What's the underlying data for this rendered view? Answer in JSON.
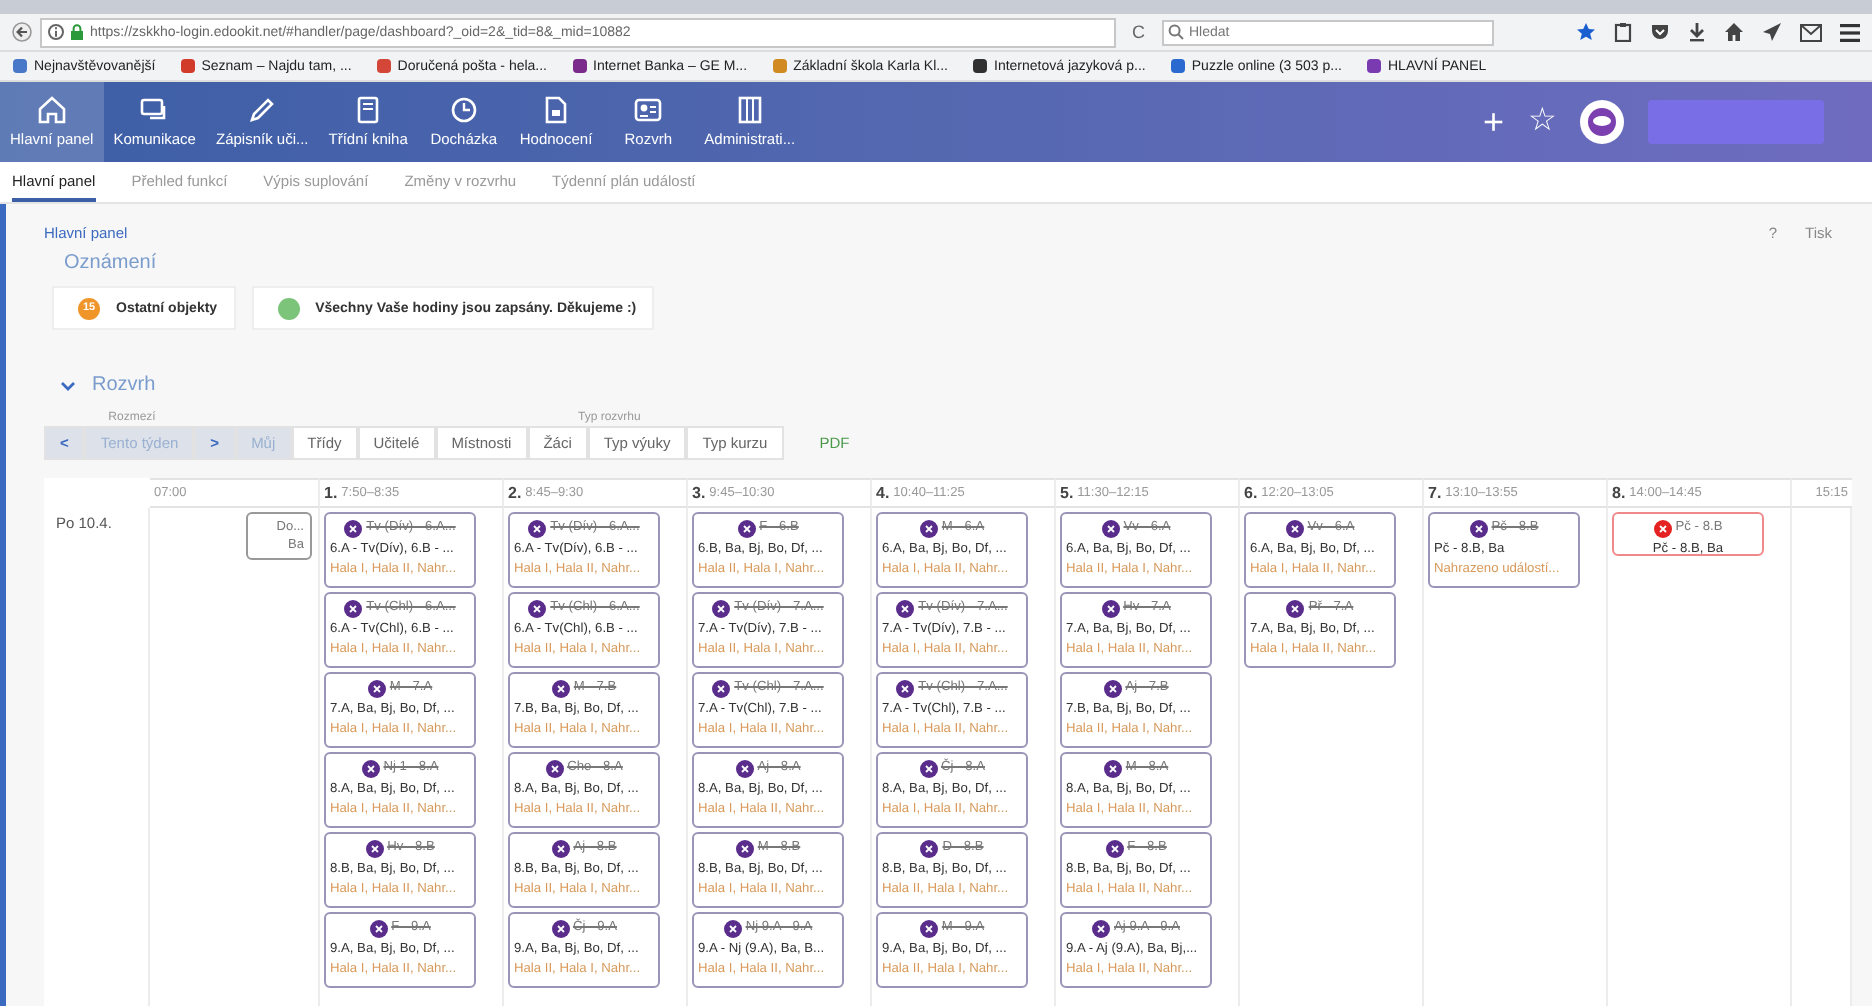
{
  "browser": {
    "url": "https://zskkho-login.edookit.net/#handler/page/dashboard?_oid=2&_tid=8&_mid=10882",
    "reload": "C",
    "search_placeholder": "Hledat",
    "bookmarks": [
      {
        "label": "Nejnavštěvovanější",
        "color": "#4a78c8"
      },
      {
        "label": "Seznam – Najdu tam, ...",
        "color": "#d23a2a"
      },
      {
        "label": "Doručená pošta - hela...",
        "color": "#d44638"
      },
      {
        "label": "Internet Banka – GE M...",
        "color": "#7a2a8a"
      },
      {
        "label": "Základní škola Karla Kl...",
        "color": "#d08a20"
      },
      {
        "label": "Internetová jazyková p...",
        "color": "#303030"
      },
      {
        "label": "Puzzle online (3 503 p...",
        "color": "#2a6ad0"
      },
      {
        "label": "HLAVNÍ PANEL",
        "color": "#7a3ab0"
      }
    ]
  },
  "app_nav": {
    "items": [
      {
        "label": "Hlavní panel",
        "selected": true
      },
      {
        "label": "Komunikace",
        "selected": false
      },
      {
        "label": "Zápisník uči...",
        "selected": false
      },
      {
        "label": "Třídní kniha",
        "selected": false
      },
      {
        "label": "Docházka",
        "selected": false
      },
      {
        "label": "Hodnocení",
        "selected": false
      },
      {
        "label": "Rozvrh",
        "selected": false
      },
      {
        "label": "Administrati...",
        "selected": false
      }
    ],
    "add": "+",
    "favorite": "☆"
  },
  "sub_tabs": [
    {
      "label": "Hlavní panel",
      "selected": true
    },
    {
      "label": "Přehled funkcí",
      "selected": false
    },
    {
      "label": "Výpis suplování",
      "selected": false
    },
    {
      "label": "Změny v rozvrhu",
      "selected": false
    },
    {
      "label": "Týdenní plán událostí",
      "selected": false
    }
  ],
  "breadcrumb": "Hlavní panel",
  "help": "?",
  "print": "Tisk",
  "announcements": {
    "title": "Oznámení",
    "items": [
      {
        "kind": "count",
        "badge": "15",
        "text": "Ostatní objekty"
      },
      {
        "kind": "ok",
        "text": "Všechny Vaše hodiny jsou zapsány. Děkujeme :)"
      }
    ]
  },
  "timetable": {
    "title": "Rozvrh",
    "expanded": true,
    "range_label": "Rozmezí",
    "prev": "<",
    "range": "Tento týden",
    "next": ">",
    "type_label": "Typ rozvrhu",
    "types": [
      {
        "label": "Můj",
        "selected": true
      },
      {
        "label": "Třídy",
        "selected": false
      },
      {
        "label": "Učitelé",
        "selected": false
      },
      {
        "label": "Místnosti",
        "selected": false
      },
      {
        "label": "Žáci",
        "selected": false
      },
      {
        "label": "Typ výuky",
        "selected": false
      },
      {
        "label": "Typ kurzu",
        "selected": false
      }
    ],
    "pdf": "PDF",
    "start_time": "07:00",
    "end_time": "15:15",
    "periods": [
      {
        "number": "1.",
        "time": "7:50–8:35"
      },
      {
        "number": "2.",
        "time": "8:45–9:30"
      },
      {
        "number": "3.",
        "time": "9:45–10:30"
      },
      {
        "number": "4.",
        "time": "10:40–11:25"
      },
      {
        "number": "5.",
        "time": "11:30–12:15"
      },
      {
        "number": "6.",
        "time": "12:20–13:05"
      },
      {
        "number": "7.",
        "time": "13:10–13:55"
      },
      {
        "number": "8.",
        "time": "14:00–14:45"
      }
    ],
    "day": {
      "label": "Po 10.4.",
      "early": {
        "title": "Do...",
        "line_2": "Ba"
      },
      "columns": [
        [
          {
            "title": "Tv (Dív) - 6.A...",
            "cancelled": true,
            "alert": false,
            "line_2": "6.A - Tv(Dív), 6.B - ...",
            "line_3": "Hala I, Hala II, Nahr..."
          },
          {
            "title": "Tv (Chl) - 6.A...",
            "cancelled": true,
            "alert": false,
            "line_2": "6.A - Tv(Chl), 6.B - ...",
            "line_3": "Hala I, Hala II, Nahr..."
          },
          {
            "title": "M - 7.A",
            "cancelled": true,
            "alert": false,
            "line_2": "7.A, Ba, Bj, Bo, Df, ...",
            "line_3": "Hala I, Hala II, Nahr..."
          },
          {
            "title": "Nj 1 - 8.A",
            "cancelled": true,
            "alert": false,
            "line_2": "8.A, Ba, Bj, Bo, Df, ...",
            "line_3": "Hala I, Hala II, Nahr..."
          },
          {
            "title": "Hv - 8.B",
            "cancelled": true,
            "alert": false,
            "line_2": "8.B, Ba, Bj, Bo, Df, ...",
            "line_3": "Hala I, Hala II, Nahr..."
          },
          {
            "title": "F - 9.A",
            "cancelled": true,
            "alert": false,
            "line_2": "9.A, Ba, Bj, Bo, Df, ...",
            "line_3": "Hala I, Hala II, Nahr..."
          }
        ],
        [
          {
            "title": "Tv (Dív) - 6.A...",
            "cancelled": true,
            "alert": false,
            "line_2": "6.A - Tv(Dív), 6.B - ...",
            "line_3": "Hala I, Hala II, Nahr..."
          },
          {
            "title": "Tv (Chl) - 6.A...",
            "cancelled": true,
            "alert": false,
            "line_2": "6.A - Tv(Chl), 6.B - ...",
            "line_3": "Hala II, Hala I, Nahr..."
          },
          {
            "title": "M - 7.B",
            "cancelled": true,
            "alert": false,
            "line_2": "7.B, Ba, Bj, Bo, Df, ...",
            "line_3": "Hala II, Hala I, Nahr..."
          },
          {
            "title": "Che - 8.A",
            "cancelled": true,
            "alert": false,
            "line_2": "8.A, Ba, Bj, Bo, Df, ...",
            "line_3": "Hala I, Hala II, Nahr..."
          },
          {
            "title": "Aj - 8.B",
            "cancelled": true,
            "alert": false,
            "line_2": "8.B, Ba, Bj, Bo, Df, ...",
            "line_3": "Hala II, Hala I, Nahr..."
          },
          {
            "title": "Čj - 9.A",
            "cancelled": true,
            "alert": false,
            "line_2": "9.A, Ba, Bj, Bo, Df, ...",
            "line_3": "Hala II, Hala I, Nahr..."
          }
        ],
        [
          {
            "title": "F - 6.B",
            "cancelled": true,
            "alert": false,
            "line_2": "6.B, Ba, Bj, Bo, Df, ...",
            "line_3": "Hala II, Hala I, Nahr..."
          },
          {
            "title": "Tv (Dív) - 7.A...",
            "cancelled": true,
            "alert": false,
            "line_2": "7.A - Tv(Dív), 7.B - ...",
            "line_3": "Hala II, Hala I, Nahr..."
          },
          {
            "title": "Tv (Chl) - 7.A...",
            "cancelled": true,
            "alert": false,
            "line_2": "7.A - Tv(Chl), 7.B - ...",
            "line_3": "Hala I, Hala II, Nahr..."
          },
          {
            "title": "Aj - 8.A",
            "cancelled": true,
            "alert": false,
            "line_2": "8.A, Ba, Bj, Bo, Df, ...",
            "line_3": "Hala I, Hala II, Nahr..."
          },
          {
            "title": "M - 8.B",
            "cancelled": true,
            "alert": false,
            "line_2": "8.B, Ba, Bj, Bo, Df, ...",
            "line_3": "Hala I, Hala II, Nahr..."
          },
          {
            "title": "Nj 9.A - 9.A",
            "cancelled": true,
            "alert": false,
            "line_2": "9.A - Nj (9.A), Ba, B...",
            "line_3": "Hala I, Hala II, Nahr..."
          }
        ],
        [
          {
            "title": "M - 6.A",
            "cancelled": true,
            "alert": false,
            "line_2": "6.A, Ba, Bj, Bo, Df, ...",
            "line_3": "Hala I, Hala II, Nahr..."
          },
          {
            "title": "Tv (Dív) - 7.A...",
            "cancelled": true,
            "alert": false,
            "line_2": "7.A - Tv(Dív), 7.B - ...",
            "line_3": "Hala I, Hala II, Nahr..."
          },
          {
            "title": "Tv (Chl) - 7.A...",
            "cancelled": true,
            "alert": false,
            "line_2": "7.A - Tv(Chl), 7.B - ...",
            "line_3": "Hala I, Hala II, Nahr..."
          },
          {
            "title": "Čj - 8.A",
            "cancelled": true,
            "alert": false,
            "line_2": "8.A, Ba, Bj, Bo, Df, ...",
            "line_3": "Hala I, Hala II, Nahr..."
          },
          {
            "title": "D - 8.B",
            "cancelled": true,
            "alert": false,
            "line_2": "8.B, Ba, Bj, Bo, Df, ...",
            "line_3": "Hala II, Hala I, Nahr..."
          },
          {
            "title": "M - 9.A",
            "cancelled": true,
            "alert": false,
            "line_2": "9.A, Ba, Bj, Bo, Df, ...",
            "line_3": "Hala II, Hala I, Nahr..."
          }
        ],
        [
          {
            "title": "Vv - 6.A",
            "cancelled": true,
            "alert": false,
            "line_2": "6.A, Ba, Bj, Bo, Df, ...",
            "line_3": "Hala II, Hala I, Nahr..."
          },
          {
            "title": "Hv - 7.A",
            "cancelled": true,
            "alert": false,
            "line_2": "7.A, Ba, Bj, Bo, Df, ...",
            "line_3": "Hala I, Hala II, Nahr..."
          },
          {
            "title": "Aj - 7.B",
            "cancelled": true,
            "alert": false,
            "line_2": "7.B, Ba, Bj, Bo, Df, ...",
            "line_3": "Hala II, Hala I, Nahr..."
          },
          {
            "title": "M - 8.A",
            "cancelled": true,
            "alert": false,
            "line_2": "8.A, Ba, Bj, Bo, Df, ...",
            "line_3": "Hala I, Hala II, Nahr..."
          },
          {
            "title": "F - 8.B",
            "cancelled": true,
            "alert": false,
            "line_2": "8.B, Ba, Bj, Bo, Df, ...",
            "line_3": "Hala I, Hala II, Nahr..."
          },
          {
            "title": "Aj 9.A - 9.A",
            "cancelled": true,
            "alert": false,
            "line_2": "9.A - Aj (9.A), Ba, Bj,...",
            "line_3": "Hala I, Hala II, Nahr..."
          }
        ],
        [
          {
            "title": "Vv - 6.A",
            "cancelled": true,
            "alert": false,
            "line_2": "6.A, Ba, Bj, Bo, Df, ...",
            "line_3": "Hala I, Hala II, Nahr..."
          },
          {
            "title": "Př - 7.A",
            "cancelled": true,
            "alert": false,
            "line_2": "7.A, Ba, Bj, Bo, Df, ...",
            "line_3": "Hala I, Hala II, Nahr..."
          }
        ],
        [
          {
            "title": "Pč - 8.B",
            "cancelled": true,
            "alert": false,
            "line_2": "Pč - 8.B, Ba",
            "line_3": "Nahrazeno událostí..."
          }
        ],
        [
          {
            "title": "Pč - 8.B",
            "cancelled": false,
            "alert": true,
            "line_2": "Pč - 8.B, Ba"
          }
        ]
      ]
    }
  }
}
